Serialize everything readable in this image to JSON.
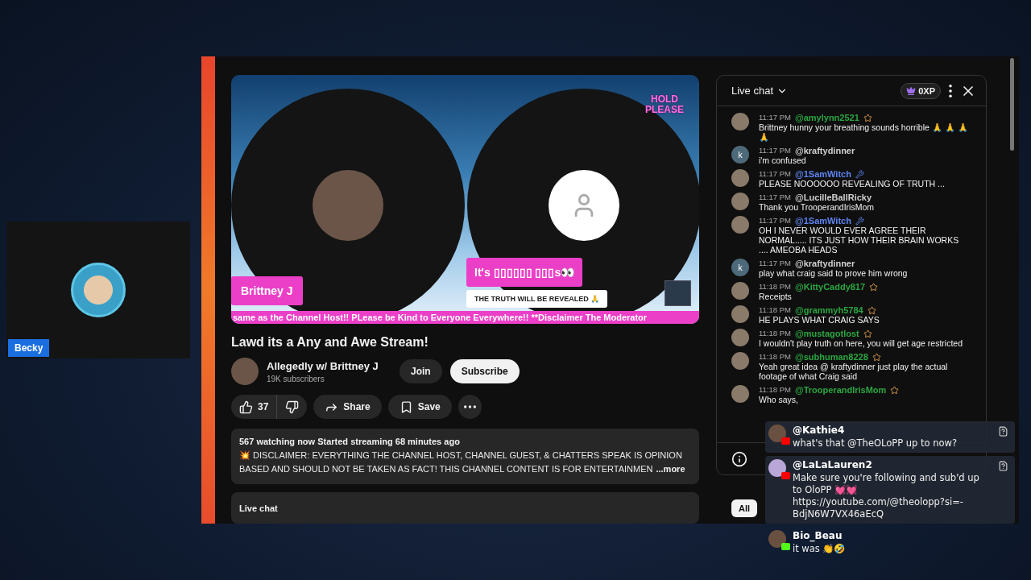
{
  "participant": {
    "name": "Becky"
  },
  "video": {
    "hold_text": "HOLD PLEASE",
    "name_tag": "Brittney J",
    "guest_tag": "It's ▯▯▯▯▯▯ ▯▯▯s👀",
    "caption": "THE TRUTH WILL BE REVEALED 🙏",
    "ticker": "same as the Channel Host!! PLease be Kind to Everyone Everywhere!! **Disclaimer The Moderator"
  },
  "title": "Lawd its a Any and Awe Stream!",
  "channel": {
    "name": "Allegedly w/ Brittney J",
    "subscribers": "19K subscribers",
    "join": "Join",
    "subscribe": "Subscribe"
  },
  "actions": {
    "likes": "37",
    "share": "Share",
    "save": "Save"
  },
  "description": {
    "stats": "567 watching now  Started streaming 68 minutes ago",
    "text": "💥 DISCLAIMER: EVERYTHING THE CHANNEL HOST, CHANNEL GUEST, & CHATTERS SPEAK IS OPINION BASED AND SHOULD NOT BE TAKEN AS FACT!  THIS CHANNEL CONTENT IS FOR ENTERTAINMEN",
    "more": "...more"
  },
  "live_chat_bar": "Live chat",
  "chat": {
    "title": "Live chat",
    "xp": "0XP",
    "messages": [
      {
        "time": "11:17 PM",
        "author": "@amylynn2521",
        "color": "#2ba640",
        "kind": "member",
        "text": "Brittney hunny your breathing sounds horrible 🙏 🙏 🙏 🙏"
      },
      {
        "time": "11:17 PM",
        "author": "@kraftydinner",
        "color": "#d0d0d0",
        "kind": "viewer",
        "letter": "k",
        "text": "i'm confused"
      },
      {
        "time": "11:17 PM",
        "author": "@1SamWitch",
        "color": "#5e84f1",
        "kind": "moderator",
        "text": "PLEASE NOOOOOO REVEALING OF TRUTH ..."
      },
      {
        "time": "11:17 PM",
        "author": "@LucilleBallRicky",
        "color": "#d0d0d0",
        "kind": "viewer",
        "text": "Thank you TrooperandIrisMom"
      },
      {
        "time": "11:17 PM",
        "author": "@1SamWitch",
        "color": "#5e84f1",
        "kind": "moderator",
        "text": "OH I NEVER WOULD EVER AGREE THEIR NORMAL..... ITS JUST HOW THEIR BRAIN WORKS .... AMEOBA HEADS"
      },
      {
        "time": "11:17 PM",
        "author": "@kraftydinner",
        "color": "#d0d0d0",
        "kind": "viewer",
        "letter": "k",
        "text": "play what craig said to prove him wrong"
      },
      {
        "time": "11:18 PM",
        "author": "@KittyCaddy817",
        "color": "#2ba640",
        "kind": "member",
        "text": "Receipts"
      },
      {
        "time": "11:18 PM",
        "author": "@grammyh5784",
        "color": "#2ba640",
        "kind": "member",
        "text": "HE PLAYS WHAT CRAIG SAYS"
      },
      {
        "time": "11:18 PM",
        "author": "@mustagotlost",
        "color": "#2ba640",
        "kind": "member",
        "text": "I wouldn't play truth on here, you will get age restricted"
      },
      {
        "time": "11:18 PM",
        "author": "@subhuman8228",
        "color": "#2ba640",
        "kind": "member",
        "text": "Yeah great idea @ kraftydinner just play the actual footage of what Craig said"
      },
      {
        "time": "11:18 PM",
        "author": "@TrooperandIrisMom",
        "color": "#2ba640",
        "kind": "member",
        "text": "Who says,"
      }
    ]
  },
  "chips": [
    {
      "label": "All",
      "selected": true
    }
  ],
  "overlay_messages": [
    {
      "author": "@Kathie4",
      "kind": "youtube",
      "boxed": true,
      "text": "what's that @TheOLoPP up to now?"
    },
    {
      "author": "@LaLaLauren2",
      "kind": "youtube",
      "boxed": true,
      "text": "Make sure you're following and sub'd up to OloPP 💓💓 https://youtube.com/@theolopp?si=-BdjN6W7VX46aEcQ"
    },
    {
      "author": "Bio_Beau",
      "kind": "kick",
      "boxed": false,
      "text": "it was 👏🤣"
    }
  ]
}
